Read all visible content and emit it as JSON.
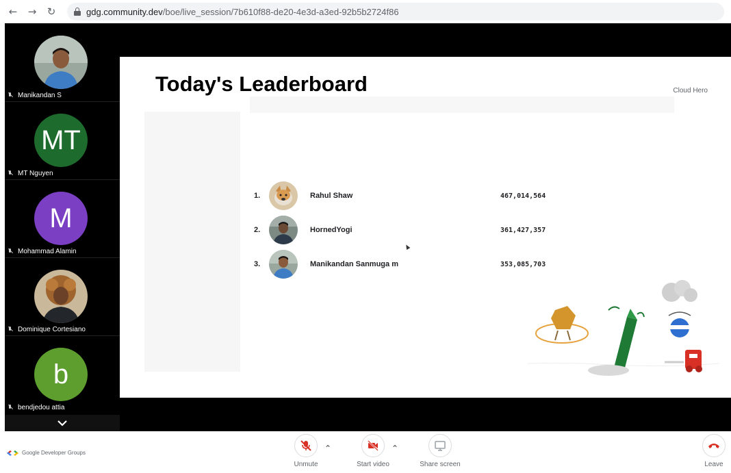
{
  "browser": {
    "url_host": "gdg.community.dev",
    "url_path": "/boe/live_session/7b610f88-de20-4e3d-a3ed-92b5b2724f86"
  },
  "participants": [
    {
      "name": "Manikandan S",
      "initials": "",
      "avatar_color": "#7b8a7e",
      "photo": true
    },
    {
      "name": "MT Nguyen",
      "initials": "MT",
      "avatar_color": "#1e6b2e",
      "photo": false
    },
    {
      "name": "Mohammad Alamin",
      "initials": "M",
      "avatar_color": "#7b3fc4",
      "photo": false
    },
    {
      "name": "Dominique Cortesiano",
      "initials": "",
      "avatar_color": "#8a5a2b",
      "photo": true
    },
    {
      "name": "bendjedou attia",
      "initials": "b",
      "avatar_color": "#5d9e2e",
      "photo": false
    }
  ],
  "slide": {
    "title": "Today's Leaderboard",
    "brand": "Cloud Hero",
    "leaderboard": [
      {
        "rank": "1.",
        "name": "Rahul Shaw",
        "score": "467,014,564"
      },
      {
        "rank": "2.",
        "name": "HornedYogi",
        "score": "361,427,357"
      },
      {
        "rank": "3.",
        "name": "Manikandan Sanmuga m",
        "score": "353,085,703"
      }
    ]
  },
  "toolbar": {
    "brand": "Google Developer Groups",
    "unmute_label": "Unmute",
    "start_video_label": "Start video",
    "share_screen_label": "Share screen",
    "leave_label": "Leave"
  },
  "colors": {
    "danger": "#d93025",
    "muted": "#5f6368"
  }
}
